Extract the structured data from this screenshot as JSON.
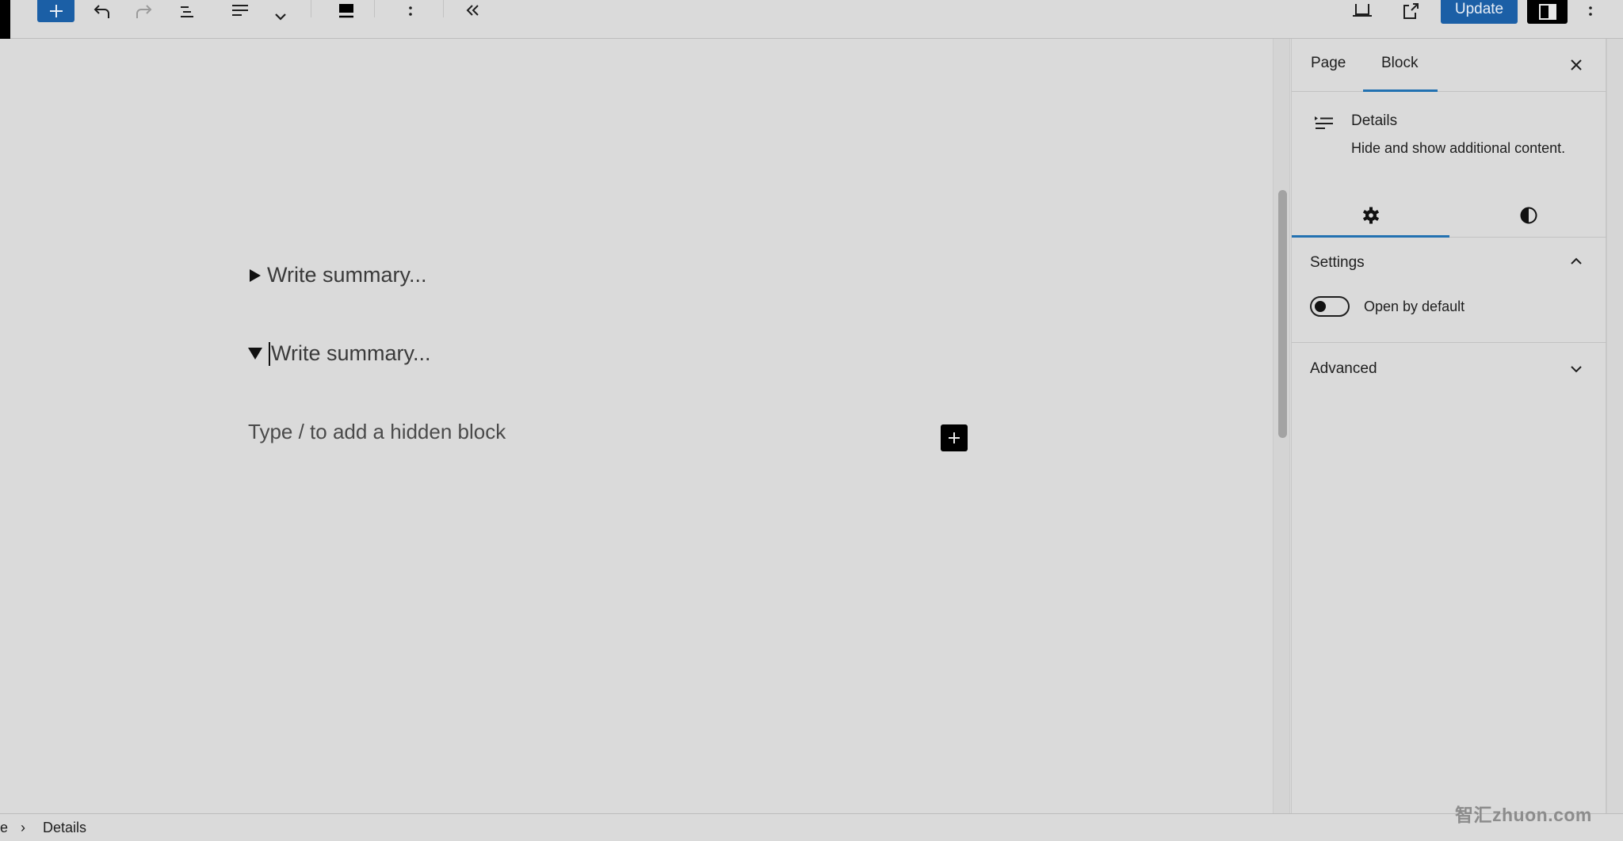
{
  "toolbar": {
    "buttons": [
      {
        "name": "block-inserter",
        "icon": "plus-icon"
      },
      {
        "name": "undo",
        "icon": "undo-icon"
      },
      {
        "name": "redo",
        "icon": "redo-icon",
        "disabled": true
      },
      {
        "name": "document-overview",
        "icon": "list-view-icon"
      },
      {
        "name": "block-type",
        "icon": "details-block-icon"
      },
      {
        "name": "block-type-dropdown",
        "icon": "chevron-down-icon"
      },
      {
        "name": "align",
        "icon": "align-bottom-icon"
      },
      {
        "name": "more-options",
        "icon": "vertical-ellipsis-icon"
      },
      {
        "name": "collapse",
        "icon": "double-chevron-left-icon"
      }
    ],
    "right": {
      "view_icon": "desktop-view-icon",
      "preview_icon": "external-link-icon",
      "update_label": "Update",
      "settings_icon": "sidebar-toggle-icon",
      "options_icon": "vertical-ellipsis-icon"
    },
    "accent_color": "#1b5fa6"
  },
  "editor": {
    "details_blocks": [
      {
        "summary_placeholder": "Write summary...",
        "expanded": false
      },
      {
        "summary_placeholder": "Write summary...",
        "expanded": true,
        "focused": true
      }
    ],
    "hidden_block_placeholder": "Type / to add a hidden block",
    "add_block_icon": "plus-icon"
  },
  "sidebar": {
    "tabs": [
      {
        "label": "Page",
        "active": false
      },
      {
        "label": "Block",
        "active": true
      }
    ],
    "close_icon": "close-icon",
    "block": {
      "icon": "details-block-icon",
      "title": "Details",
      "description": "Hide and show additional content."
    },
    "subtabs": [
      {
        "icon": "gear-icon",
        "name": "settings",
        "active": true
      },
      {
        "icon": "half-circle-icon",
        "name": "styles",
        "active": false
      }
    ],
    "panels": {
      "settings": {
        "title": "Settings",
        "expanded": true,
        "toggle_label": "Open by default",
        "toggle_on": false
      },
      "advanced": {
        "title": "Advanced",
        "expanded": false
      }
    }
  },
  "footer": {
    "breadcrumb": [
      {
        "label": "e"
      },
      {
        "label": "Details"
      }
    ],
    "separator": "›"
  },
  "watermark": "智汇zhuon.com"
}
